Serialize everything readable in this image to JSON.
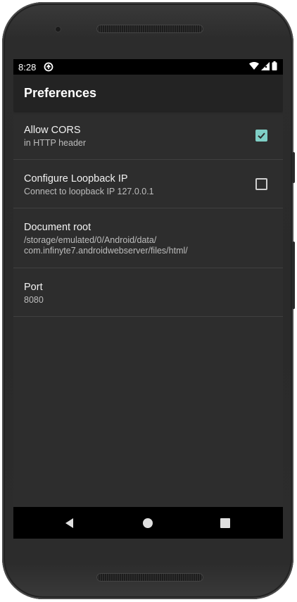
{
  "status_bar": {
    "time": "8:28",
    "app_icon": "sync-circle-icon",
    "icons": [
      "wifi-icon",
      "cell-signal-icon",
      "battery-icon"
    ]
  },
  "app_bar": {
    "title": "Preferences"
  },
  "preferences": [
    {
      "title": "Allow CORS",
      "summary": "in HTTP header",
      "checkbox": true,
      "checked": true
    },
    {
      "title": "Configure Loopback IP",
      "summary": "Connect to loopback IP 127.0.0.1",
      "checkbox": true,
      "checked": false
    },
    {
      "title": "Document root",
      "summary_lines": [
        "/storage/emulated/0/Android/data/",
        "com.infinyte7.androidwebserver/files/html/"
      ],
      "checkbox": false
    },
    {
      "title": "Port",
      "summary": "8080",
      "checkbox": false
    }
  ],
  "nav_bar": {
    "buttons": [
      "back-icon",
      "home-icon",
      "recents-icon"
    ]
  },
  "colors": {
    "accent": "#7fcfc6",
    "background": "#2d2d2d",
    "app_bar": "#232323",
    "status_bar": "#000000",
    "divider": "#404040"
  }
}
